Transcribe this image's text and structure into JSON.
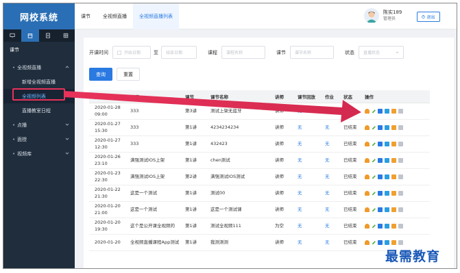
{
  "app": {
    "title": "网校系统"
  },
  "sidebar": {
    "group_label": "课节",
    "items": [
      {
        "label": "全视频直播",
        "expanded": true
      },
      {
        "label": "新增全视频直播"
      },
      {
        "label": "全视频列表",
        "active": true
      },
      {
        "label": "直播教室日程"
      },
      {
        "label": "点播"
      },
      {
        "label": "面授"
      },
      {
        "label": "视频库"
      }
    ]
  },
  "header": {
    "tabs": [
      {
        "label": "课节"
      },
      {
        "label": "全视频直播"
      },
      {
        "label": "全视频直播列表",
        "active": true
      }
    ],
    "user": {
      "name": "陈实189",
      "role": "管理员"
    },
    "logout_label": "退出"
  },
  "filters": {
    "start_time_label": "开课时间",
    "start_date_placeholder": "开始日期",
    "to_label": "至",
    "end_date_placeholder": "结束日期",
    "course_label": "课程",
    "course_placeholder": "课程名称",
    "lesson_label": "课节",
    "lesson_placeholder": "课节名称",
    "status_label": "状态",
    "status_placeholder": "直播状态",
    "query_button": "查询",
    "reset_button": "重置"
  },
  "table": {
    "headers": [
      "开课时间",
      "课程",
      "课节",
      "课节名称",
      "讲师",
      "课节回放",
      "作业",
      "状态",
      "操作"
    ],
    "rows": [
      {
        "time": "2020-01-28 09:00",
        "course": "333",
        "lesson": "第3讲",
        "name": "测试上架无蓝牙",
        "teacher": "讲师",
        "replay": "无",
        "homework": "无",
        "status": ""
      },
      {
        "time": "2020-01-27 15:30",
        "course": "333",
        "lesson": "第1讲",
        "name": "4234234234",
        "teacher": "讲师",
        "replay": "无",
        "homework": "无",
        "status": "已结束"
      },
      {
        "time": "2020-01-27 12:30",
        "course": "333",
        "lesson": "第1讲",
        "name": "432423",
        "teacher": "讲师",
        "replay": "无",
        "homework": "无",
        "status": "已结束"
      },
      {
        "time": "2020-01-26 23:10",
        "course": "满强测试IOS上架",
        "lesson": "第1讲",
        "name": "chen测试",
        "teacher": "讲师",
        "replay": "无",
        "homework": "无",
        "status": "已结束"
      },
      {
        "time": "2020-01-23 22:30",
        "course": "满强测试IOS上架",
        "lesson": "第2讲",
        "name": "满强测试IOS测试",
        "teacher": "讲师",
        "replay": "无",
        "homework": "无",
        "status": "已结束"
      },
      {
        "time": "2020-01-22 21:30",
        "course": "这是一个测试",
        "lesson": "第1讲",
        "name": "测试00",
        "teacher": "讲师",
        "replay": "无",
        "homework": "无",
        "status": "已结束"
      },
      {
        "time": "2020-01-20 21:00",
        "course": "这是一个测试",
        "lesson": "第1讲",
        "name": "这是一个测试课",
        "teacher": "讲师",
        "replay": "无",
        "homework": "无",
        "status": "已结束"
      },
      {
        "time": "2020-01-20 19:30",
        "course": "这个是公开课全视频的",
        "lesson": "第1讲",
        "name": "测试全视频111",
        "teacher": "为空",
        "replay": "无",
        "homework": "无",
        "status": "已结束"
      },
      {
        "time": "2020-01-20",
        "course": "全视频直播课程App测试",
        "lesson": "第1讲",
        "name": "我测测测",
        "teacher": "讲师",
        "replay": "无",
        "homework": "无",
        "status": "已结束"
      }
    ]
  },
  "colors": {
    "accent": "#2a7ae2",
    "sidebar": "#1f2d3d",
    "highlight": "#e8325a"
  },
  "watermark": "最需教育"
}
